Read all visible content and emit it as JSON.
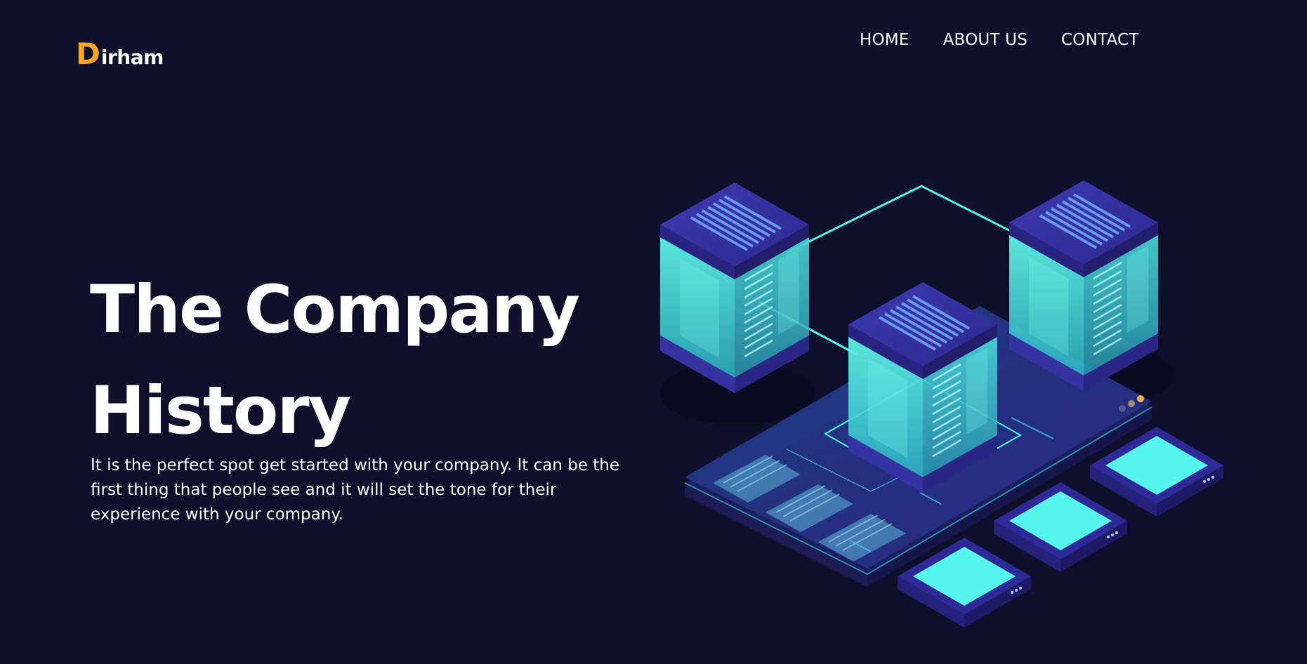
{
  "brand": {
    "initial": "D",
    "rest": "irham",
    "accent_color": "#f6a623"
  },
  "nav": {
    "items": [
      {
        "label": "HOME"
      },
      {
        "label": "ABOUT US"
      },
      {
        "label": "CONTACT"
      }
    ]
  },
  "hero": {
    "title_line1": "The Company",
    "title_line2": "History",
    "description": "It is the perfect spot get started with your company. It can be the first thing that people see and it will set the tone for their experience with your company."
  },
  "theme": {
    "background": "#0d0f2b",
    "text": "#ffffff",
    "illustration_cyan": "#4ff5ea",
    "illustration_purple": "#3a34a8"
  }
}
